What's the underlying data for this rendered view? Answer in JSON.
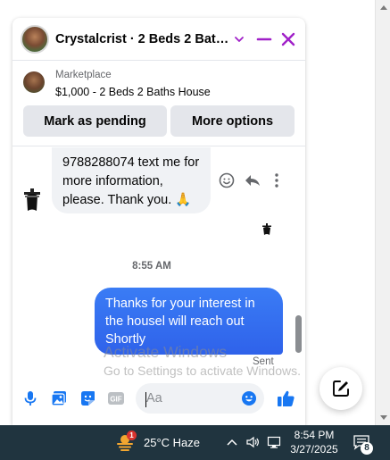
{
  "chat": {
    "title": "Crystalcrist · 2 Beds 2 Bath...",
    "accent_color": "#a020c8",
    "marketplace": {
      "label": "Marketplace",
      "listing_title": "$1,000 - 2 Beds 2 Baths House",
      "mark_pending_label": "Mark as pending",
      "more_options_label": "More options"
    },
    "messages": {
      "incoming_text": "9788288074 text me for more information, please. Thank you. 🙏",
      "timestamp": "8:55 AM",
      "outgoing_text": "Thanks for your interest in the housel will reach out Shortly",
      "outgoing_color": "#2f62ea",
      "status": "Sent"
    },
    "composer": {
      "placeholder": "Aa"
    }
  },
  "watermark": {
    "title": "Activate Windows",
    "subtitle": "Go to Settings to activate Windows."
  },
  "taskbar": {
    "weather_badge": "1",
    "weather_text": "25°C  Haze",
    "time": "8:54 PM",
    "date": "3/27/2025",
    "notification_count": "8"
  }
}
